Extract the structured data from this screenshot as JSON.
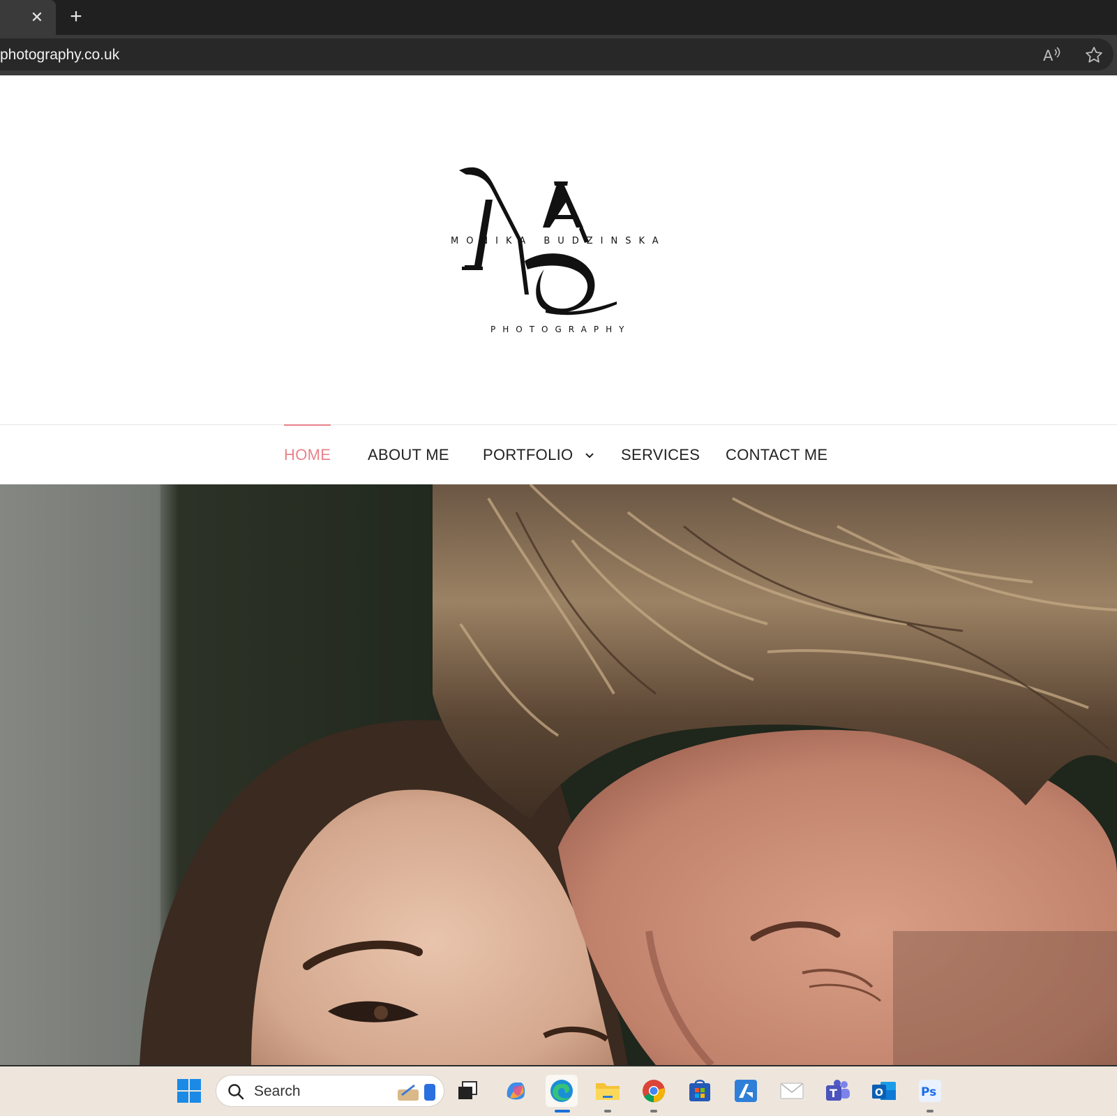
{
  "browser": {
    "url": "photography.co.uk"
  },
  "site": {
    "logo_name": "MONIKA BUDZINSKA",
    "logo_sub": "PHOTOGRAPHY",
    "nav": [
      {
        "label": "HOME",
        "active": true
      },
      {
        "label": "ABOUT ME",
        "active": false
      },
      {
        "label": "PORTFOLIO",
        "active": false,
        "has_dropdown": true
      },
      {
        "label": "SERVICES",
        "active": false
      },
      {
        "label": "CONTACT ME",
        "active": false
      }
    ],
    "accent_color": "#e8828a"
  },
  "taskbar": {
    "search_placeholder": "Search",
    "apps": [
      "start-icon",
      "task-view-icon",
      "copilot-icon",
      "edge-icon",
      "file-explorer-icon",
      "chrome-icon",
      "store-icon",
      "app-icon",
      "mail-icon",
      "teams-icon",
      "outlook-icon",
      "photoshop-icon"
    ]
  }
}
